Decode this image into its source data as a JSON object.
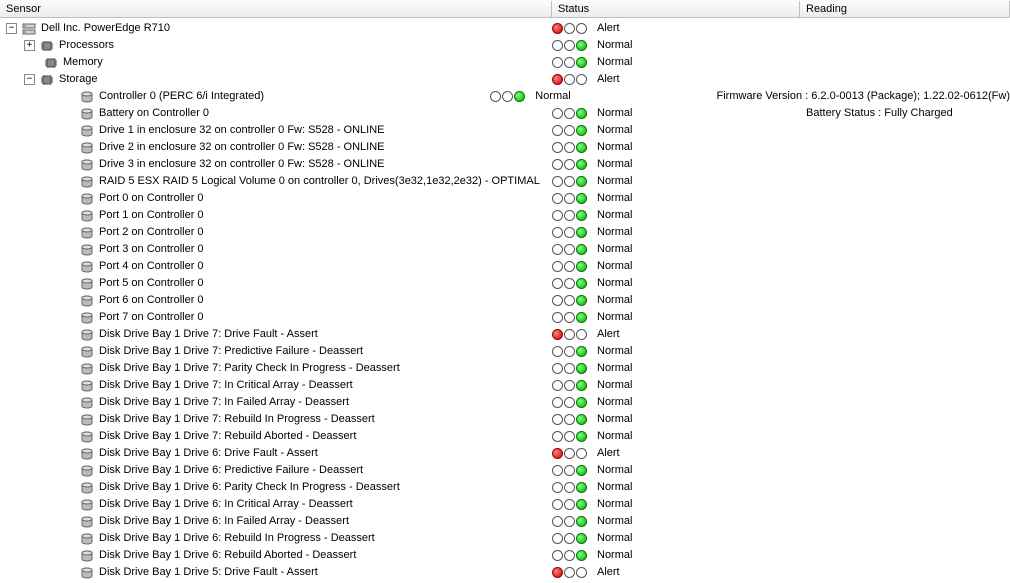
{
  "headers": {
    "sensor": "Sensor",
    "status": "Status",
    "reading": "Reading"
  },
  "rows": [
    {
      "indent": 0,
      "expander": "minus",
      "icon": "server",
      "label": "Dell Inc. PowerEdge R710",
      "status": "alert",
      "statusText": "Alert",
      "reading": ""
    },
    {
      "indent": 1,
      "expander": "plus",
      "icon": "chip",
      "label": "Processors",
      "status": "normal",
      "statusText": "Normal",
      "reading": ""
    },
    {
      "indent": 1,
      "expander": "none",
      "icon": "chip",
      "label": "Memory",
      "status": "normal",
      "statusText": "Normal",
      "reading": ""
    },
    {
      "indent": 1,
      "expander": "minus",
      "icon": "chip",
      "label": "Storage",
      "status": "alert",
      "statusText": "Alert",
      "reading": ""
    },
    {
      "indent": 2,
      "expander": "none",
      "icon": "disk",
      "label": "Controller 0 (PERC 6/i Integrated)",
      "status": "normal",
      "statusText": "Normal",
      "reading": "Firmware Version : 6.2.0-0013 (Package); 1.22.02-0612(Fw)"
    },
    {
      "indent": 2,
      "expander": "none",
      "icon": "disk",
      "label": "Battery on Controller 0",
      "status": "normal",
      "statusText": "Normal",
      "reading": "Battery Status : Fully Charged"
    },
    {
      "indent": 2,
      "expander": "none",
      "icon": "disk",
      "label": "Drive 1 in enclosure 32 on controller 0 Fw: S528 - ONLINE",
      "status": "normal",
      "statusText": "Normal",
      "reading": ""
    },
    {
      "indent": 2,
      "expander": "none",
      "icon": "disk",
      "label": "Drive 2 in enclosure 32 on controller 0 Fw: S528 - ONLINE",
      "status": "normal",
      "statusText": "Normal",
      "reading": ""
    },
    {
      "indent": 2,
      "expander": "none",
      "icon": "disk",
      "label": "Drive 3 in enclosure 32 on controller 0 Fw: S528 - ONLINE",
      "status": "normal",
      "statusText": "Normal",
      "reading": ""
    },
    {
      "indent": 2,
      "expander": "none",
      "icon": "disk",
      "label": "RAID 5 ESX RAID 5 Logical Volume 0 on controller 0, Drives(3e32,1e32,2e32)  - OPTIMAL",
      "status": "normal",
      "statusText": "Normal",
      "reading": ""
    },
    {
      "indent": 2,
      "expander": "none",
      "icon": "disk",
      "label": "Port 0 on Controller 0",
      "status": "normal",
      "statusText": "Normal",
      "reading": ""
    },
    {
      "indent": 2,
      "expander": "none",
      "icon": "disk",
      "label": "Port 1 on Controller 0",
      "status": "normal",
      "statusText": "Normal",
      "reading": ""
    },
    {
      "indent": 2,
      "expander": "none",
      "icon": "disk",
      "label": "Port 2 on Controller 0",
      "status": "normal",
      "statusText": "Normal",
      "reading": ""
    },
    {
      "indent": 2,
      "expander": "none",
      "icon": "disk",
      "label": "Port 3 on Controller 0",
      "status": "normal",
      "statusText": "Normal",
      "reading": ""
    },
    {
      "indent": 2,
      "expander": "none",
      "icon": "disk",
      "label": "Port 4 on Controller 0",
      "status": "normal",
      "statusText": "Normal",
      "reading": ""
    },
    {
      "indent": 2,
      "expander": "none",
      "icon": "disk",
      "label": "Port 5 on Controller 0",
      "status": "normal",
      "statusText": "Normal",
      "reading": ""
    },
    {
      "indent": 2,
      "expander": "none",
      "icon": "disk",
      "label": "Port 6 on Controller 0",
      "status": "normal",
      "statusText": "Normal",
      "reading": ""
    },
    {
      "indent": 2,
      "expander": "none",
      "icon": "disk",
      "label": "Port 7 on Controller 0",
      "status": "normal",
      "statusText": "Normal",
      "reading": ""
    },
    {
      "indent": 2,
      "expander": "none",
      "icon": "disk",
      "label": "Disk Drive Bay 1 Drive 7: Drive Fault - Assert",
      "status": "alert",
      "statusText": "Alert",
      "reading": ""
    },
    {
      "indent": 2,
      "expander": "none",
      "icon": "disk",
      "label": "Disk Drive Bay 1 Drive 7: Predictive Failure - Deassert",
      "status": "normal",
      "statusText": "Normal",
      "reading": ""
    },
    {
      "indent": 2,
      "expander": "none",
      "icon": "disk",
      "label": "Disk Drive Bay 1 Drive 7: Parity Check In Progress - Deassert",
      "status": "normal",
      "statusText": "Normal",
      "reading": ""
    },
    {
      "indent": 2,
      "expander": "none",
      "icon": "disk",
      "label": "Disk Drive Bay 1 Drive 7: In Critical Array - Deassert",
      "status": "normal",
      "statusText": "Normal",
      "reading": ""
    },
    {
      "indent": 2,
      "expander": "none",
      "icon": "disk",
      "label": "Disk Drive Bay 1 Drive 7: In Failed Array - Deassert",
      "status": "normal",
      "statusText": "Normal",
      "reading": ""
    },
    {
      "indent": 2,
      "expander": "none",
      "icon": "disk",
      "label": "Disk Drive Bay 1 Drive 7: Rebuild In Progress - Deassert",
      "status": "normal",
      "statusText": "Normal",
      "reading": ""
    },
    {
      "indent": 2,
      "expander": "none",
      "icon": "disk",
      "label": "Disk Drive Bay 1 Drive 7: Rebuild Aborted - Deassert",
      "status": "normal",
      "statusText": "Normal",
      "reading": ""
    },
    {
      "indent": 2,
      "expander": "none",
      "icon": "disk",
      "label": "Disk Drive Bay 1 Drive 6: Drive Fault - Assert",
      "status": "alert",
      "statusText": "Alert",
      "reading": ""
    },
    {
      "indent": 2,
      "expander": "none",
      "icon": "disk",
      "label": "Disk Drive Bay 1 Drive 6: Predictive Failure - Deassert",
      "status": "normal",
      "statusText": "Normal",
      "reading": ""
    },
    {
      "indent": 2,
      "expander": "none",
      "icon": "disk",
      "label": "Disk Drive Bay 1 Drive 6: Parity Check In Progress - Deassert",
      "status": "normal",
      "statusText": "Normal",
      "reading": ""
    },
    {
      "indent": 2,
      "expander": "none",
      "icon": "disk",
      "label": "Disk Drive Bay 1 Drive 6: In Critical Array - Deassert",
      "status": "normal",
      "statusText": "Normal",
      "reading": ""
    },
    {
      "indent": 2,
      "expander": "none",
      "icon": "disk",
      "label": "Disk Drive Bay 1 Drive 6: In Failed Array - Deassert",
      "status": "normal",
      "statusText": "Normal",
      "reading": ""
    },
    {
      "indent": 2,
      "expander": "none",
      "icon": "disk",
      "label": "Disk Drive Bay 1 Drive 6: Rebuild In Progress - Deassert",
      "status": "normal",
      "statusText": "Normal",
      "reading": ""
    },
    {
      "indent": 2,
      "expander": "none",
      "icon": "disk",
      "label": "Disk Drive Bay 1 Drive 6: Rebuild Aborted - Deassert",
      "status": "normal",
      "statusText": "Normal",
      "reading": ""
    },
    {
      "indent": 2,
      "expander": "none",
      "icon": "disk",
      "label": "Disk Drive Bay 1 Drive 5: Drive Fault - Assert",
      "status": "alert",
      "statusText": "Alert",
      "reading": ""
    }
  ]
}
